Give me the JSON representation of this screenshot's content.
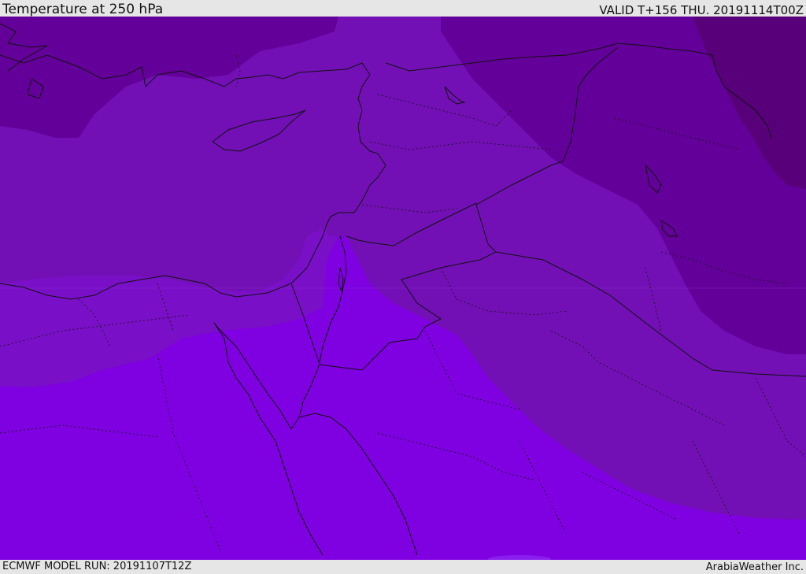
{
  "header": {
    "title": "Temperature at 250 hPa",
    "valid_time": "VALID T+156 THU. 20191114T00Z"
  },
  "footer": {
    "model_run": "ECMWF MODEL RUN: 20191107T12Z",
    "credit": "ArabiaWeather Inc."
  },
  "map": {
    "variable": "Temperature",
    "level": "250 hPa",
    "colors": {
      "band_coldest": "#570079",
      "band_cold": "#64009a",
      "band_mid": "#7210b5",
      "band_warm": "#7a0fc8",
      "band_warmest": "#7f00e0",
      "borders": "#111111"
    }
  }
}
